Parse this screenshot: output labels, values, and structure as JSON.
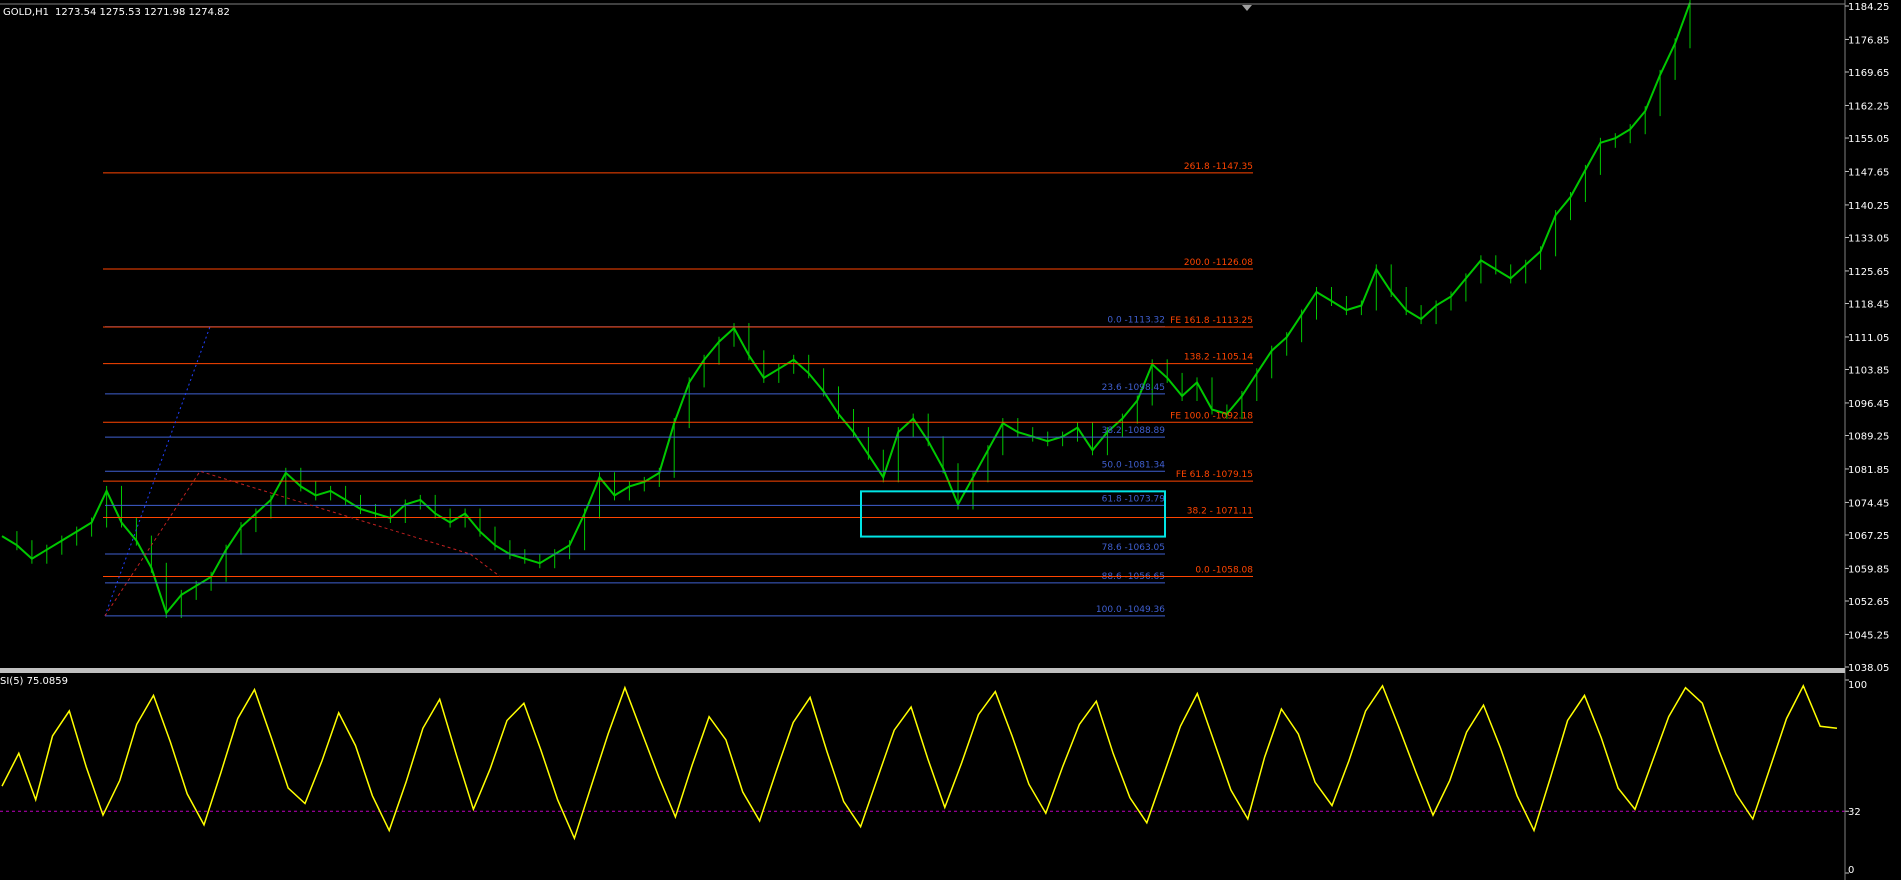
{
  "header": {
    "symbol": "GOLD,H1",
    "ohlc": "1273.54 1275.53 1271.98 1274.82"
  },
  "rsi_panel": {
    "label": "SI(5) 75.0859"
  },
  "colors": {
    "background": "#000000",
    "candles": "#00c800",
    "rsi_line": "#ffff00",
    "fib_retracement": "#3f5fd0",
    "fib_expansion": "#ff4500",
    "highlight_box": "#00e5e5",
    "axis_text": "#ffffff",
    "separator": "#c0c0c0",
    "rsi_level": "#c000c0"
  },
  "chart_data": [
    {
      "type": "line",
      "title": "GOLD,H1",
      "series": [
        {
          "values": [
            1067,
            1065,
            1062,
            1064,
            1066,
            1068,
            1070,
            1077,
            1070,
            1066,
            1060,
            1050,
            1054,
            1056,
            1058,
            1064,
            1069,
            1072,
            1075,
            1081,
            1078,
            1076,
            1077,
            1075,
            1073,
            1072,
            1071,
            1074,
            1075,
            1072,
            1070,
            1072,
            1068,
            1065,
            1063,
            1062,
            1061,
            1063,
            1065,
            1072,
            1080,
            1076,
            1078,
            1079,
            1081,
            1092,
            1101,
            1106,
            1110,
            1113,
            1107,
            1102,
            1104,
            1106,
            1103,
            1099,
            1094,
            1090,
            1085,
            1080,
            1090,
            1093,
            1088,
            1082,
            1074,
            1080,
            1086,
            1092,
            1090,
            1089,
            1088,
            1089,
            1091,
            1086,
            1090,
            1093,
            1097,
            1105,
            1102,
            1098,
            1101,
            1095,
            1094,
            1098,
            1103,
            1108,
            1111,
            1116,
            1121,
            1119,
            1117,
            1118,
            1126,
            1121,
            1117,
            1115,
            1118,
            1120,
            1124,
            1128,
            1126,
            1124,
            1127,
            1130,
            1138,
            1142,
            1148,
            1154,
            1155,
            1157,
            1161,
            1169,
            1176,
            1185
          ]
        }
      ],
      "y_ticks": [
        "1184.25",
        "1176.85",
        "1169.65",
        "1162.25",
        "1155.05",
        "1147.65",
        "1140.25",
        "1133.05",
        "1125.65",
        "1118.45",
        "1111.05",
        "1103.85",
        "1096.45",
        "1089.25",
        "1081.85",
        "1074.45",
        "1067.25",
        "1059.85",
        "1052.65",
        "1045.25",
        "1038.05"
      ],
      "ylim": [
        1038.05,
        1184.25
      ],
      "grid": false,
      "fib_retracement_labels": [
        "0.0 -1113.32",
        "23.6 -1098.45",
        "38.2 -1088.89",
        "50.0 -1081.34",
        "61.8 -1073.79",
        "78.6 -1063.05",
        "88.6 -1056.65",
        "100.0 -1049.36"
      ],
      "fib_expansion_labels": [
        "261.8 -1147.35",
        "200.0 -1126.08",
        "FE 161.8 -1113.25",
        "138.2 -1105.14",
        "FE 100.0 -1092.18",
        "FE 61.8 -1079.15",
        "38.2 - 1071.11",
        "0.0 -1058.08"
      ]
    },
    {
      "type": "line",
      "title": "SI(5) 75.0859",
      "y_ticks": [
        "100",
        "32",
        "0"
      ],
      "ylim": [
        0,
        100
      ],
      "level": 32,
      "series": [
        {
          "values": [
            45,
            62,
            38,
            71,
            84,
            55,
            30,
            48,
            77,
            92,
            68,
            41,
            25,
            52,
            80,
            95,
            70,
            44,
            36,
            58,
            83,
            66,
            40,
            22,
            47,
            75,
            90,
            61,
            33,
            54,
            79,
            88,
            64,
            38,
            18,
            45,
            72,
            96,
            73,
            50,
            29,
            56,
            81,
            69,
            42,
            27,
            53,
            78,
            91,
            63,
            37,
            24,
            49,
            74,
            86,
            59,
            34,
            57,
            82,
            94,
            71,
            46,
            31,
            55,
            77,
            89,
            62,
            39,
            26,
            51,
            76,
            93,
            68,
            43,
            28,
            60,
            85,
            72,
            47,
            35,
            58,
            84,
            97,
            75,
            52,
            30,
            48,
            73,
            87,
            65,
            40,
            22,
            50,
            79,
            92,
            70,
            44,
            33,
            57,
            81,
            96,
            88,
            63,
            41,
            28,
            54,
            80,
            97,
            76,
            75
          ]
        }
      ]
    }
  ]
}
